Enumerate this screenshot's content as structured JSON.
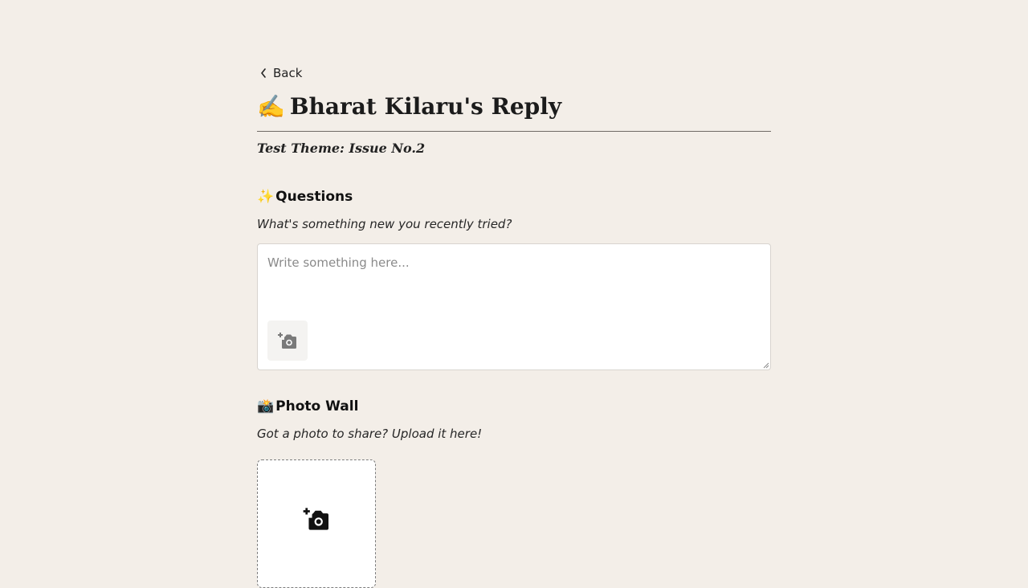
{
  "nav": {
    "back_label": "Back"
  },
  "header": {
    "title_emoji": "✍️",
    "title": "Bharat Kilaru's Reply",
    "theme": "Test Theme: Issue No.2"
  },
  "questions": {
    "heading_emoji": "✨",
    "heading": "Questions",
    "prompt": "What's something new you recently tried?",
    "answer_value": "",
    "answer_placeholder": "Write something here..."
  },
  "photo_wall": {
    "heading_emoji": "📸",
    "heading": "Photo Wall",
    "prompt": "Got a photo to share? Upload it here!"
  },
  "icons": {
    "back": "chevron-left-icon",
    "add_photo": "add-photo-icon"
  },
  "colors": {
    "background": "#f3eee8",
    "text": "#1f1f1f",
    "border": "#d8d4cf",
    "icon_muted": "#7a7a7a",
    "icon_dark": "#111111"
  }
}
